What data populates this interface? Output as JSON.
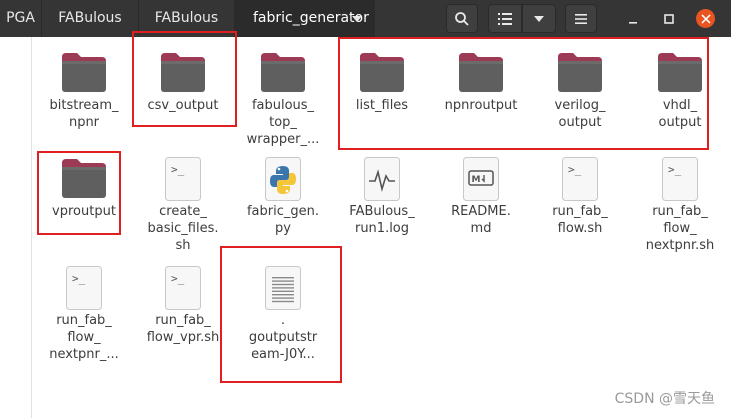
{
  "header": {
    "crumbs": [
      "PGA",
      "FABulous",
      "FABulous",
      "fabric_generator"
    ],
    "icons": [
      "search-icon",
      "list-view-icon",
      "chevron-down-icon",
      "hamburger-menu-icon",
      "minimize-icon",
      "maximize-icon",
      "close-icon"
    ]
  },
  "files": [
    {
      "label": "bitstream_\nnpnr",
      "type": "folder"
    },
    {
      "label": "csv_output",
      "type": "folder"
    },
    {
      "label": "fabulous_\ntop_\nwrapper_...",
      "type": "folder"
    },
    {
      "label": "list_files",
      "type": "folder"
    },
    {
      "label": "npnroutput",
      "type": "folder"
    },
    {
      "label": "verilog_\noutput",
      "type": "folder"
    },
    {
      "label": "vhdl_\noutput",
      "type": "folder"
    },
    {
      "label": "vproutput",
      "type": "folder"
    },
    {
      "label": "create_\nbasic_files.\nsh",
      "type": "script"
    },
    {
      "label": "fabric_gen.\npy",
      "type": "python"
    },
    {
      "label": "FABulous_\nrun1.log",
      "type": "log"
    },
    {
      "label": "README.\nmd",
      "type": "markdown"
    },
    {
      "label": "run_fab_\nflow.sh",
      "type": "script"
    },
    {
      "label": "run_fab_\nflow_\nnextpnr.sh",
      "type": "script"
    },
    {
      "label": "run_fab_\nflow_\nnextpnr_...",
      "type": "script"
    },
    {
      "label": "run_fab_\nflow_vpr.sh",
      "type": "script"
    },
    {
      "label": ".\ngoutputstr\neam-J0Y...",
      "type": "text"
    }
  ],
  "watermark": "CSDN @雪天鱼",
  "colors": {
    "header_bg": "#353535",
    "folder_tab": "#9d3b56",
    "folder_body": "#5f5f5f",
    "close_button": "#e95420",
    "annotation_box": "#e02020"
  }
}
